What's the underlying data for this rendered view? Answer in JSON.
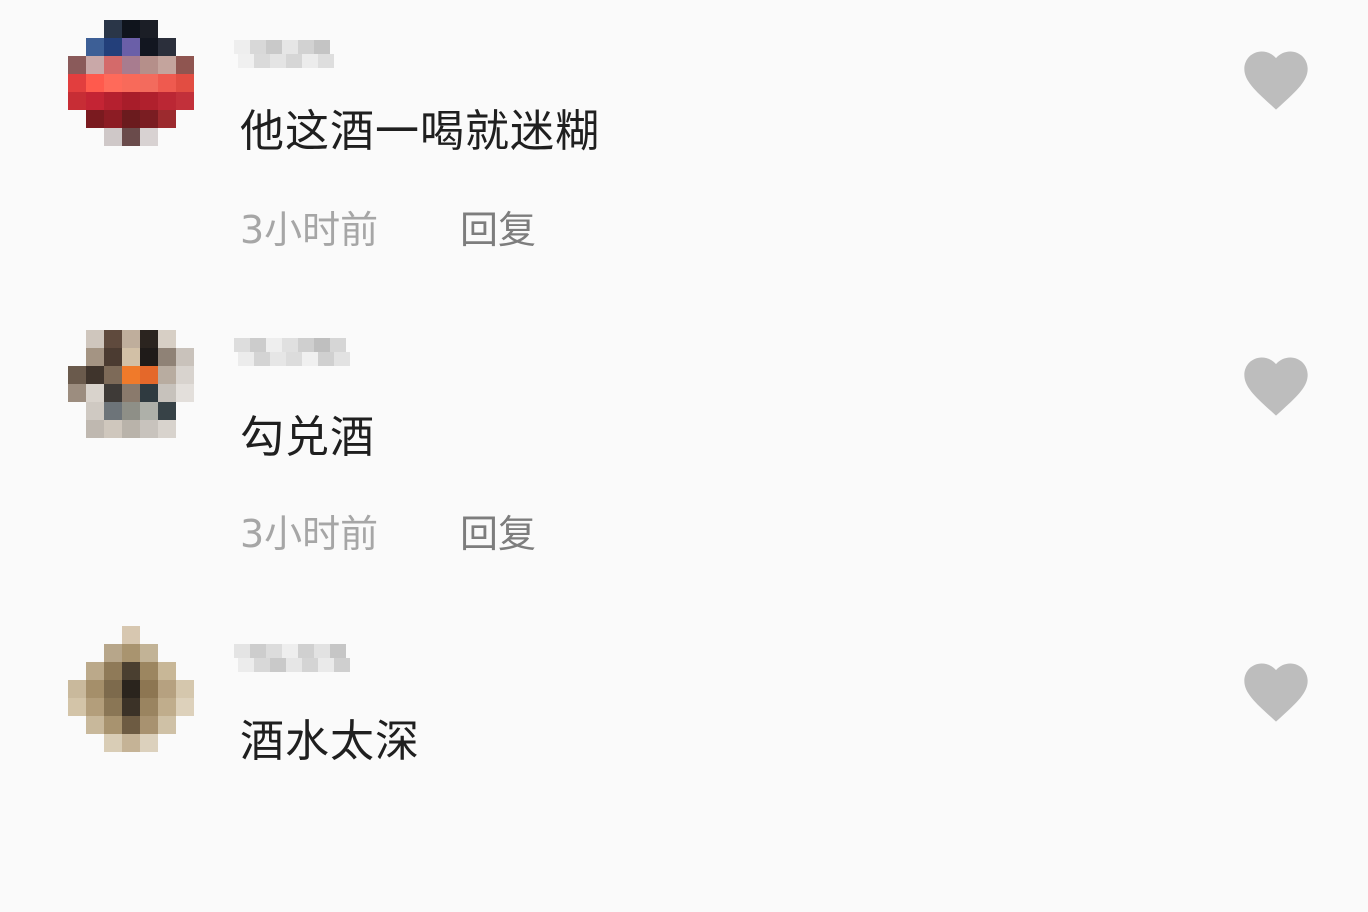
{
  "comments": [
    {
      "text": "他这酒一喝就迷糊",
      "time": "3小时前",
      "reply_label": "回复"
    },
    {
      "text": "勾兑酒",
      "time": "3小时前",
      "reply_label": "回复"
    },
    {
      "text": "酒水太深"
    }
  ],
  "colors": {
    "background": "#fafafa",
    "like_icon": "#bdbdbd",
    "timestamp": "#a6a6a6",
    "reply": "#7d7d7d",
    "comment_text": "#1f1f1f"
  },
  "icons": {
    "like": "heart-icon"
  }
}
